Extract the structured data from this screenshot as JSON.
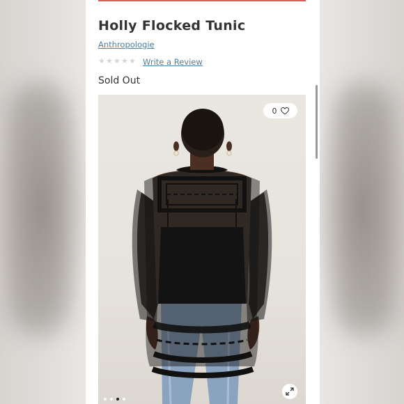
{
  "product": {
    "title": "Holly Flocked Tunic",
    "brand": "Anthropologie",
    "rating_stars": 0,
    "review_link": "Write a Review",
    "availability": "Sold Out"
  },
  "gallery": {
    "favorite_count": "0",
    "slide_count": 4,
    "active_slide": 3
  },
  "colors": {
    "accent_rule": "#e0595b",
    "link": "#4a7fa7",
    "star_empty": "#d6d6d6"
  },
  "icons": {
    "favorite": "heart-icon",
    "expand": "expand-icon",
    "star": "star-icon"
  }
}
